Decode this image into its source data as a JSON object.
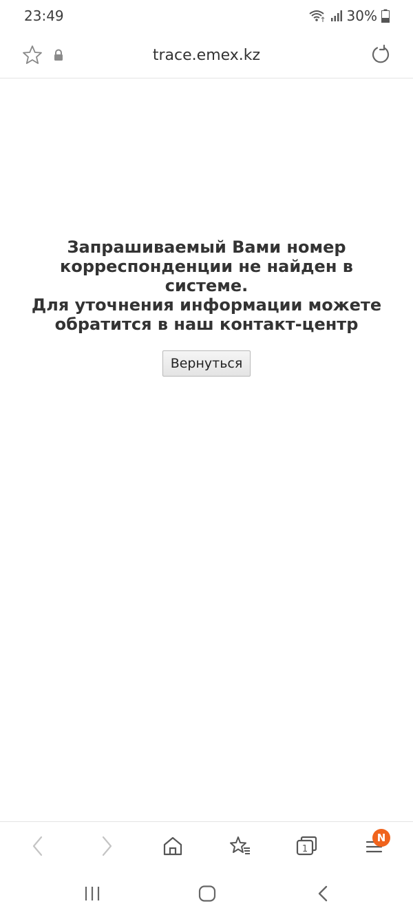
{
  "status_bar": {
    "time": "23:49",
    "battery": "30%",
    "icons": [
      "wifi-icon",
      "signal-icon",
      "battery-icon"
    ]
  },
  "url_bar": {
    "url": "trace.emex.kz",
    "icons": [
      "star-icon",
      "lock-icon",
      "reload-icon"
    ]
  },
  "main": {
    "message_lines": [
      "Запрашиваемый Вами номер",
      "корреспонденции не найден в системе.",
      "Для уточнения информации можете",
      "обратится в наш контакт-центр"
    ],
    "back_button": "Вернуться"
  },
  "toolbar": {
    "items": [
      "back-icon",
      "forward-icon",
      "home-icon",
      "bookmarks-icon",
      "tabs-icon",
      "menu-icon"
    ],
    "tabs_count": "1",
    "menu_badge": "N",
    "badge_color": "#f0631c"
  },
  "navbar": {
    "items": [
      "recent-apps-icon",
      "home-button-icon",
      "back-nav-icon"
    ]
  }
}
